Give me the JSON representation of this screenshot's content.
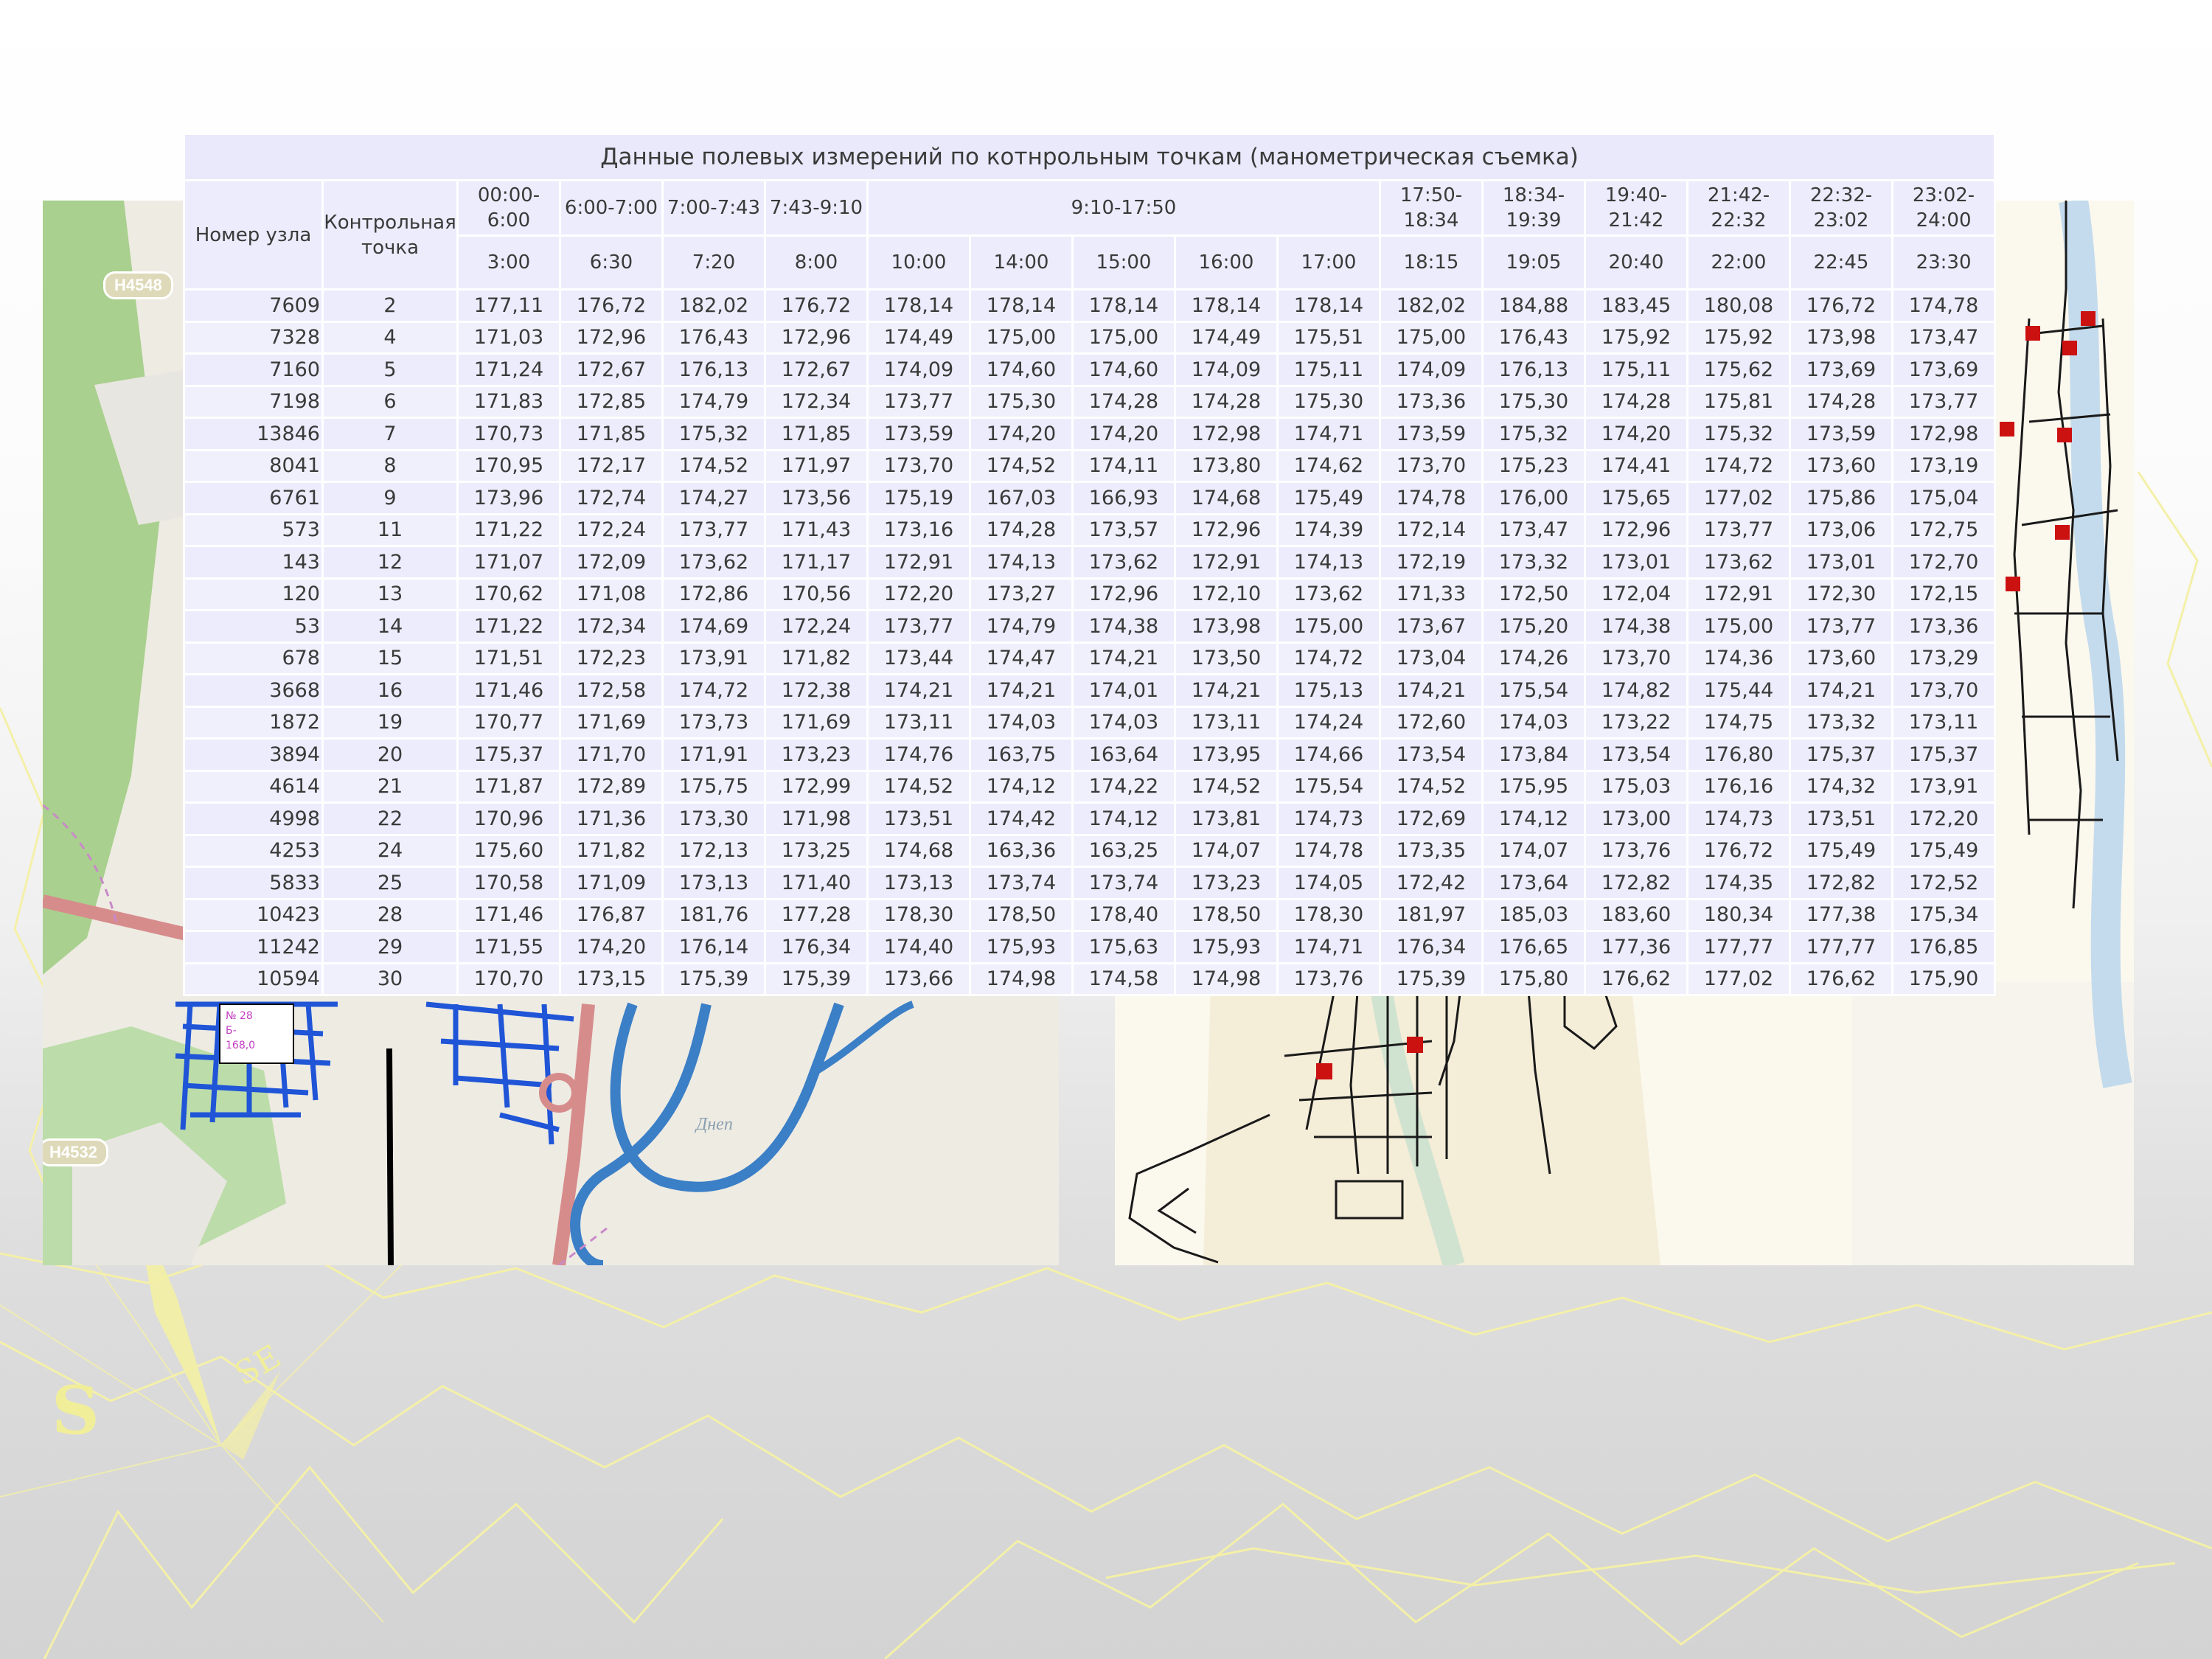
{
  "table": {
    "title": "Данные полевых измерений по котнрольным точкам (манометрическая съемка)",
    "col_node": "Номер узла",
    "col_point": "Контрольная точка",
    "time_ranges": [
      {
        "label": "00:00-6:00",
        "span": 1
      },
      {
        "label": "6:00-7:00",
        "span": 1
      },
      {
        "label": "7:00-7:43",
        "span": 1
      },
      {
        "label": "7:43-9:10",
        "span": 1
      },
      {
        "label": "9:10-17:50",
        "span": 5
      },
      {
        "label": "17:50-18:34",
        "span": 1
      },
      {
        "label": "18:34-19:39",
        "span": 1
      },
      {
        "label": "19:40-21:42",
        "span": 1
      },
      {
        "label": "21:42-22:32",
        "span": 1
      },
      {
        "label": "22:32-23:02",
        "span": 1
      },
      {
        "label": "23:02-24:00",
        "span": 1
      }
    ],
    "times": [
      "3:00",
      "6:30",
      "7:20",
      "8:00",
      "10:00",
      "14:00",
      "15:00",
      "16:00",
      "17:00",
      "18:15",
      "19:05",
      "20:40",
      "22:00",
      "22:45",
      "23:30"
    ],
    "rows": [
      {
        "node": "7609",
        "point": "2",
        "values": [
          "177,11",
          "176,72",
          "182,02",
          "176,72",
          "178,14",
          "178,14",
          "178,14",
          "178,14",
          "178,14",
          "182,02",
          "184,88",
          "183,45",
          "180,08",
          "176,72",
          "174,78"
        ]
      },
      {
        "node": "7328",
        "point": "4",
        "values": [
          "171,03",
          "172,96",
          "176,43",
          "172,96",
          "174,49",
          "175,00",
          "175,00",
          "174,49",
          "175,51",
          "175,00",
          "176,43",
          "175,92",
          "175,92",
          "173,98",
          "173,47"
        ]
      },
      {
        "node": "7160",
        "point": "5",
        "values": [
          "171,24",
          "172,67",
          "176,13",
          "172,67",
          "174,09",
          "174,60",
          "174,60",
          "174,09",
          "175,11",
          "174,09",
          "176,13",
          "175,11",
          "175,62",
          "173,69",
          "173,69"
        ]
      },
      {
        "node": "7198",
        "point": "6",
        "values": [
          "171,83",
          "172,85",
          "174,79",
          "172,34",
          "173,77",
          "175,30",
          "174,28",
          "174,28",
          "175,30",
          "173,36",
          "175,30",
          "174,28",
          "175,81",
          "174,28",
          "173,77"
        ]
      },
      {
        "node": "13846",
        "point": "7",
        "values": [
          "170,73",
          "171,85",
          "175,32",
          "171,85",
          "173,59",
          "174,20",
          "174,20",
          "172,98",
          "174,71",
          "173,59",
          "175,32",
          "174,20",
          "175,32",
          "173,59",
          "172,98"
        ]
      },
      {
        "node": "8041",
        "point": "8",
        "values": [
          "170,95",
          "172,17",
          "174,52",
          "171,97",
          "173,70",
          "174,52",
          "174,11",
          "173,80",
          "174,62",
          "173,70",
          "175,23",
          "174,41",
          "174,72",
          "173,60",
          "173,19"
        ]
      },
      {
        "node": "6761",
        "point": "9",
        "values": [
          "173,96",
          "172,74",
          "174,27",
          "173,56",
          "175,19",
          "167,03",
          "166,93",
          "174,68",
          "175,49",
          "174,78",
          "176,00",
          "175,65",
          "177,02",
          "175,86",
          "175,04"
        ]
      },
      {
        "node": "573",
        "point": "11",
        "values": [
          "171,22",
          "172,24",
          "173,77",
          "171,43",
          "173,16",
          "174,28",
          "173,57",
          "172,96",
          "174,39",
          "172,14",
          "173,47",
          "172,96",
          "173,77",
          "173,06",
          "172,75"
        ]
      },
      {
        "node": "143",
        "point": "12",
        "values": [
          "171,07",
          "172,09",
          "173,62",
          "171,17",
          "172,91",
          "174,13",
          "173,62",
          "172,91",
          "174,13",
          "172,19",
          "173,32",
          "173,01",
          "173,62",
          "173,01",
          "172,70"
        ]
      },
      {
        "node": "120",
        "point": "13",
        "values": [
          "170,62",
          "171,08",
          "172,86",
          "170,56",
          "172,20",
          "173,27",
          "172,96",
          "172,10",
          "173,62",
          "171,33",
          "172,50",
          "172,04",
          "172,91",
          "172,30",
          "172,15"
        ]
      },
      {
        "node": "53",
        "point": "14",
        "values": [
          "171,22",
          "172,34",
          "174,69",
          "172,24",
          "173,77",
          "174,79",
          "174,38",
          "173,98",
          "175,00",
          "173,67",
          "175,20",
          "174,38",
          "175,00",
          "173,77",
          "173,36"
        ]
      },
      {
        "node": "678",
        "point": "15",
        "values": [
          "171,51",
          "172,23",
          "173,91",
          "171,82",
          "173,44",
          "174,47",
          "174,21",
          "173,50",
          "174,72",
          "173,04",
          "174,26",
          "173,70",
          "174,36",
          "173,60",
          "173,29"
        ]
      },
      {
        "node": "3668",
        "point": "16",
        "values": [
          "171,46",
          "172,58",
          "174,72",
          "172,38",
          "174,21",
          "174,21",
          "174,01",
          "174,21",
          "175,13",
          "174,21",
          "175,54",
          "174,82",
          "175,44",
          "174,21",
          "173,70"
        ]
      },
      {
        "node": "1872",
        "point": "19",
        "values": [
          "170,77",
          "171,69",
          "173,73",
          "171,69",
          "173,11",
          "174,03",
          "174,03",
          "173,11",
          "174,24",
          "172,60",
          "174,03",
          "173,22",
          "174,75",
          "173,32",
          "173,11"
        ]
      },
      {
        "node": "3894",
        "point": "20",
        "values": [
          "175,37",
          "171,70",
          "171,91",
          "173,23",
          "174,76",
          "163,75",
          "163,64",
          "173,95",
          "174,66",
          "173,54",
          "173,84",
          "173,54",
          "176,80",
          "175,37",
          "175,37"
        ]
      },
      {
        "node": "4614",
        "point": "21",
        "values": [
          "171,87",
          "172,89",
          "175,75",
          "172,99",
          "174,52",
          "174,12",
          "174,22",
          "174,52",
          "175,54",
          "174,52",
          "175,95",
          "175,03",
          "176,16",
          "174,32",
          "173,91"
        ]
      },
      {
        "node": "4998",
        "point": "22",
        "values": [
          "170,96",
          "171,36",
          "173,30",
          "171,98",
          "173,51",
          "174,42",
          "174,12",
          "173,81",
          "174,73",
          "172,69",
          "174,12",
          "173,00",
          "174,73",
          "173,51",
          "172,20"
        ]
      },
      {
        "node": "4253",
        "point": "24",
        "values": [
          "175,60",
          "171,82",
          "172,13",
          "173,25",
          "174,68",
          "163,36",
          "163,25",
          "174,07",
          "174,78",
          "173,35",
          "174,07",
          "173,76",
          "176,72",
          "175,49",
          "175,49"
        ]
      },
      {
        "node": "5833",
        "point": "25",
        "values": [
          "170,58",
          "171,09",
          "173,13",
          "171,40",
          "173,13",
          "173,74",
          "173,74",
          "173,23",
          "174,05",
          "172,42",
          "173,64",
          "172,82",
          "174,35",
          "172,82",
          "172,52"
        ]
      },
      {
        "node": "10423",
        "point": "28",
        "values": [
          "171,46",
          "176,87",
          "181,76",
          "177,28",
          "178,30",
          "178,50",
          "178,40",
          "178,50",
          "178,30",
          "181,97",
          "185,03",
          "183,60",
          "180,34",
          "177,38",
          "175,34"
        ]
      },
      {
        "node": "11242",
        "point": "29",
        "values": [
          "171,55",
          "174,20",
          "176,14",
          "176,34",
          "174,40",
          "175,93",
          "175,63",
          "175,93",
          "174,71",
          "176,34",
          "176,65",
          "177,36",
          "177,77",
          "177,77",
          "176,85"
        ]
      },
      {
        "node": "10594",
        "point": "30",
        "values": [
          "170,70",
          "173,15",
          "175,39",
          "175,39",
          "173,66",
          "174,98",
          "174,58",
          "174,98",
          "173,76",
          "175,39",
          "175,80",
          "176,62",
          "177,02",
          "176,62",
          "175,90"
        ]
      }
    ]
  },
  "map_left": {
    "road_labels": [
      "H4548",
      "H4532"
    ],
    "river_label": "Днеп",
    "annotation": [
      "№ 28",
      "Б-",
      "168,0"
    ]
  },
  "decor": {
    "compass_letter": "S"
  }
}
